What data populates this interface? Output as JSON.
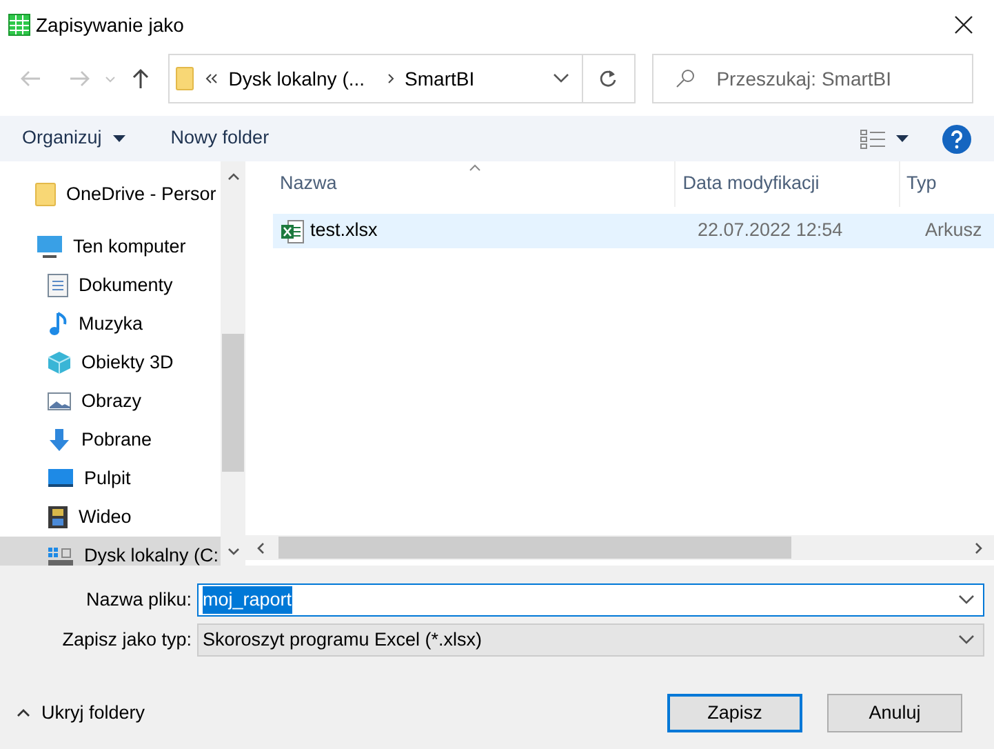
{
  "window": {
    "title": "Zapisywanie jako"
  },
  "address": {
    "path": [
      "Dysk lokalny (...",
      "SmartBI"
    ]
  },
  "search": {
    "placeholder": "Przeszukaj: SmartBI"
  },
  "toolbar": {
    "organize": "Organizuj",
    "new_folder": "Nowy folder"
  },
  "nav": [
    {
      "label": "OneDrive - Persor",
      "kind": "folder",
      "selected": false
    },
    {
      "label": "Ten komputer",
      "kind": "computer",
      "selected": false,
      "children": [
        {
          "label": "Dokumenty",
          "kind": "documents",
          "selected": false
        },
        {
          "label": "Muzyka",
          "kind": "music",
          "selected": false
        },
        {
          "label": "Obiekty 3D",
          "kind": "cube",
          "selected": false
        },
        {
          "label": "Obrazy",
          "kind": "pictures",
          "selected": false
        },
        {
          "label": "Pobrane",
          "kind": "download",
          "selected": false
        },
        {
          "label": "Pulpit",
          "kind": "desktop",
          "selected": false
        },
        {
          "label": "Wideo",
          "kind": "video",
          "selected": false
        },
        {
          "label": "Dysk lokalny (C:",
          "kind": "drive",
          "selected": true
        }
      ]
    }
  ],
  "files": {
    "columns": [
      {
        "label": "Nazwa",
        "sorted": true
      },
      {
        "label": "Data modyfikacji",
        "sorted": false
      },
      {
        "label": "Typ",
        "sorted": false
      }
    ],
    "rows": [
      {
        "name": "test.xlsx",
        "modified": "22.07.2022 12:54",
        "type": "Arkusz",
        "selected": true
      }
    ]
  },
  "form": {
    "filename_label": "Nazwa pliku:",
    "filename": "moj_raport",
    "filetype_label": "Zapisz jako typ:",
    "filetype": "Skoroszyt programu Excel (*.xlsx)"
  },
  "footer": {
    "hide_folders": "Ukryj foldery",
    "buttons": [
      {
        "label": "Zapisz",
        "default": true
      },
      {
        "label": "Anuluj",
        "default": false
      }
    ]
  }
}
